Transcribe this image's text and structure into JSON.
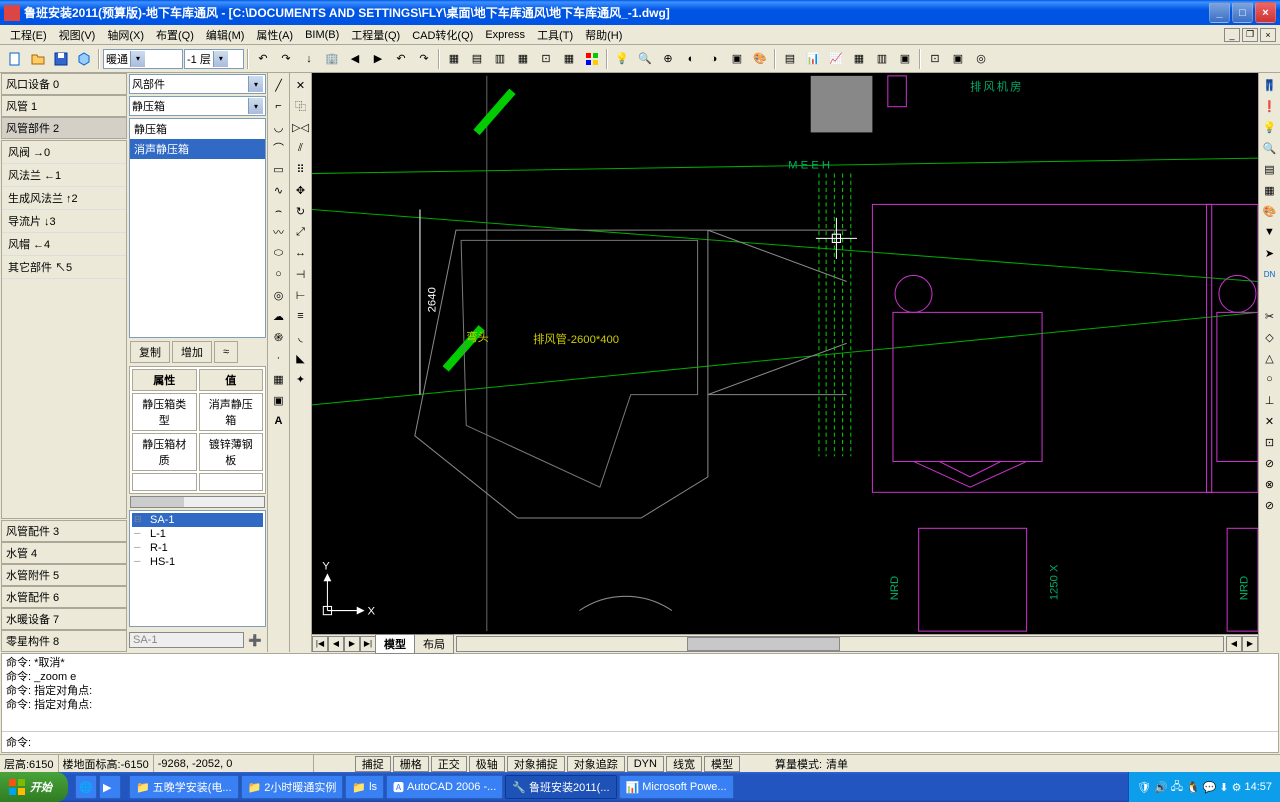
{
  "title": "鲁班安装2011(预算版)-地下车库通风 - [C:\\DOCUMENTS AND SETTINGS\\FLY\\桌面\\地下车库通风\\地下车库通风_-1.dwg]",
  "menus": [
    "工程(E)",
    "视图(V)",
    "轴网(X)",
    "布置(Q)",
    "编辑(M)",
    "属性(A)",
    "BIM(B)",
    "工程量(Q)",
    "CAD转化(Q)",
    "Express",
    "工具(T)",
    "帮助(H)"
  ],
  "toolbar": {
    "discipline": "暖通",
    "floor": "-1 层"
  },
  "left_panel": {
    "groups": [
      {
        "label": "风口设备 0"
      },
      {
        "label": "风管 1"
      },
      {
        "label": "风管部件 2"
      }
    ],
    "subitems": [
      {
        "icon": "valve",
        "label": "风阀 →0"
      },
      {
        "icon": "flange",
        "label": "风法兰 ←1"
      },
      {
        "icon": "genflange",
        "label": "生成风法兰 ↑2"
      },
      {
        "icon": "guide",
        "label": "导流片 ↓3"
      },
      {
        "icon": "cap",
        "label": "风帽 ←4"
      },
      {
        "icon": "other",
        "label": "其它部件 ↖5"
      }
    ],
    "bottom_groups": [
      {
        "label": "风管配件 3"
      },
      {
        "label": "水管 4"
      },
      {
        "label": "水管附件 5"
      },
      {
        "label": "水管配件 6"
      },
      {
        "label": "水暖设备 7"
      },
      {
        "label": "零星构件 8"
      }
    ]
  },
  "mid_panel": {
    "combo1": "风部件",
    "combo2": "静压箱",
    "list": [
      "静压箱",
      "消声静压箱"
    ],
    "list_selected": 1,
    "btn_copy": "复制",
    "btn_add": "增加",
    "btn_expand": "≈",
    "prop_headers": [
      "属性",
      "值"
    ],
    "props": [
      {
        "k": "静压箱类型",
        "v": "消声静压箱"
      },
      {
        "k": "静压箱材质",
        "v": "镀锌薄钢板"
      }
    ],
    "tree": [
      "SA-1",
      "L-1",
      "R-1",
      "HS-1"
    ],
    "tree_selected": 0,
    "tree_status": "SA-1"
  },
  "canvas": {
    "dim_text": "2640",
    "label_wantou": "弯头",
    "label_pipe": "排风管-2600*400",
    "label_meeh": "MEEH",
    "label_room": "排风机房",
    "label_nrd1": "NRD",
    "label_nrd2": "NRD",
    "label_1250": "1250 X",
    "axis_x": "X",
    "axis_y": "Y",
    "tabs": [
      "模型",
      "布局"
    ],
    "active_tab": 0
  },
  "cmdline": {
    "history": [
      "命令: *取消*",
      "命令:  _zoom  e",
      "命令: 指定对角点:",
      "命令: 指定对角点:"
    ],
    "prompt": "命令:"
  },
  "status": {
    "floor_h": "层高:6150",
    "floor_elev": "楼地面标高:-6150",
    "coords": "-9268, -2052, 0",
    "toggles": [
      "捕捉",
      "栅格",
      "正交",
      "极轴",
      "对象捕捉",
      "对象追踪",
      "DYN",
      "线宽",
      "模型"
    ],
    "mode_label": "算量模式:",
    "mode_value": "清单"
  },
  "taskbar": {
    "start": "开始",
    "items": [
      {
        "label": "五晚学安装(电..."
      },
      {
        "label": "2小时暖通实例"
      },
      {
        "label": "ls"
      },
      {
        "label": "AutoCAD 2006 -..."
      },
      {
        "label": "鲁班安装2011(...",
        "active": true
      },
      {
        "label": "Microsoft Powe..."
      }
    ],
    "clock": "14:57"
  }
}
